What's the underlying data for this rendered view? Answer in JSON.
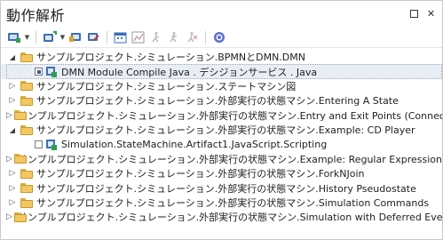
{
  "window": {
    "title": "動作解析"
  },
  "toolbar": {
    "buttons": [
      {
        "name": "simulate-icon"
      },
      {
        "name": "add-analyzer-icon"
      },
      {
        "name": "script-icon"
      },
      {
        "name": "calendar-icon"
      },
      {
        "name": "edit-script-icon"
      },
      {
        "name": "run-icon"
      },
      {
        "name": "debug-run-icon"
      },
      {
        "name": "stop-run-icon"
      },
      {
        "name": "help-icon"
      }
    ]
  },
  "tree": {
    "rows": [
      {
        "label": "サンプルプロジェクト.シミュレーション.BPMNとDMN.DMN",
        "expanded": true
      },
      {
        "label": "DMN Module Compile Java . デシジョンサービス . Java",
        "child": true,
        "selected": true,
        "checked": true
      },
      {
        "label": "サンプルプロジェクト.シミュレーション.ステートマシン図",
        "expanded": false
      },
      {
        "label": "サンプルプロジェクト.シミュレーション.外部実行の状態マシン.Entering A State",
        "expanded": false
      },
      {
        "label": "サンプルプロジェクト.シミュレーション.外部実行の状態マシン.Entry and Exit Points (Connection Point References)",
        "expanded": false
      },
      {
        "label": "サンプルプロジェクト.シミュレーション.外部実行の状態マシン.Example: CD Player",
        "expanded": true
      },
      {
        "label": "Simulation.StateMachine.Artifact1.JavaScript.Scripting",
        "child": true,
        "selected": false,
        "checked": false
      },
      {
        "label": "サンプルプロジェクト.シミュレーション.外部実行の状態マシン.Example: Regular Expression Parser",
        "expanded": false
      },
      {
        "label": "サンプルプロジェクト.シミュレーション.外部実行の状態マシン.ForkNJoin",
        "expanded": false
      },
      {
        "label": "サンプルプロジェクト.シミュレーション.外部実行の状態マシン.History Pseudostate",
        "expanded": false
      },
      {
        "label": "サンプルプロジェクト.シミュレーション.外部実行の状態マシン.Simulation Commands",
        "expanded": false
      },
      {
        "label": "サンプルプロジェクト.シミュレーション.外部実行の状態マシン.Simulation with Deferred Event",
        "expanded": false
      }
    ]
  }
}
